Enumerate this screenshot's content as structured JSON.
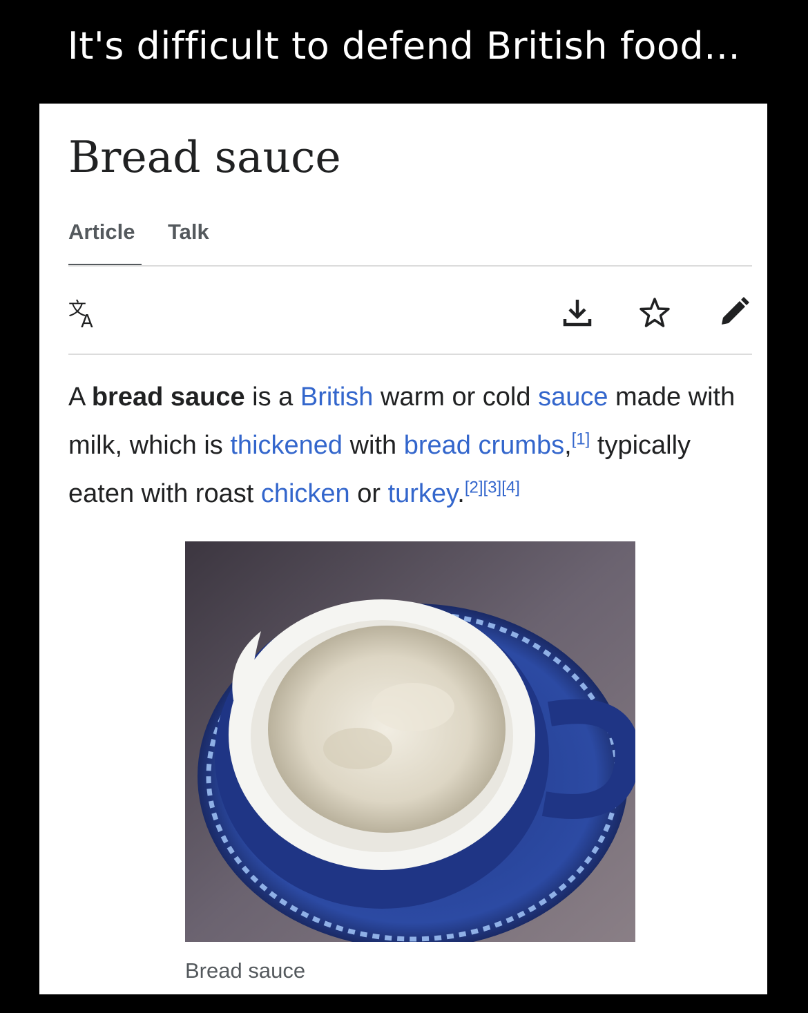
{
  "meme_caption": "It's difficult to defend British food...",
  "article": {
    "title": "Bread sauce",
    "tabs": [
      {
        "label": "Article",
        "selected": true
      },
      {
        "label": "Talk",
        "selected": false
      }
    ],
    "toolbar": {
      "language_icon": "translate-icon",
      "download_icon": "download-icon",
      "watch_icon": "star-icon",
      "edit_icon": "pencil-icon"
    },
    "lead": {
      "p1": "A ",
      "bold": "bread sauce",
      "p2": " is a ",
      "link_british": "British",
      "p3": " warm or cold ",
      "link_sauce": "sauce",
      "p4": " made with milk, which is ",
      "link_thickened": "thickened",
      "p5": " with ",
      "link_breadcrumbs": "bread crumbs",
      "p6": ",",
      "ref1": "[1]",
      "p7": " typically eaten with roast ",
      "link_chicken": "chicken",
      "p8": " or ",
      "link_turkey": "turkey",
      "p9": ".",
      "ref2": "[2]",
      "ref3": "[3]",
      "ref4": "[4]"
    },
    "image_caption": "Bread sauce"
  },
  "colors": {
    "link": "#3366cc",
    "text": "#202122",
    "muted": "#54595d",
    "background": "#000000"
  }
}
